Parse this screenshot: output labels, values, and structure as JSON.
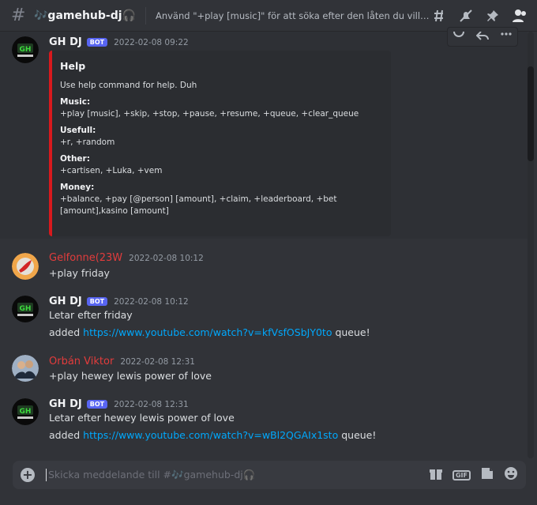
{
  "header": {
    "channel_name": "🎶gamehub-dj🎧",
    "topic": "Använd \"+play [music]\" för att söka efter den låten du vill höra, \"+skip fö...",
    "icons": [
      "threads-icon",
      "muted-bell-icon",
      "pin-icon",
      "members-icon"
    ]
  },
  "message_toolbar": {
    "icons": [
      "add-reaction-icon",
      "reply-icon",
      "more-icon"
    ]
  },
  "messages": [
    {
      "author": "GH DJ",
      "bot_badge": "BOT",
      "timestamp": "2022-02-08 09:22",
      "embed": {
        "title": "Help",
        "description": "Use help command for help. Duh",
        "fields": [
          {
            "name": "Music:",
            "value": "+play [music], +skip, +stop, +pause, +resume, +queue, +clear_queue"
          },
          {
            "name": "Usefull:",
            "value": "+r, +random"
          },
          {
            "name": "Other:",
            "value": "+cartisen, +Luka, +vem"
          },
          {
            "name": "Money:",
            "value": "+balance, +pay [@person] [amount], +claim, +leaderboard, +bet [amount],kasino [amount]"
          }
        ]
      }
    },
    {
      "author": "Gelfonne(23W",
      "timestamp": "2022-02-08 10:12",
      "text": "+play friday"
    },
    {
      "author": "GH DJ",
      "bot_badge": "BOT",
      "timestamp": "2022-02-08 10:12",
      "text": "Letar efter friday",
      "text2_prefix": "added ",
      "text2_link": "https://www.youtube.com/watch?v=kfVsfOSbJY0to",
      "text2_suffix": " queue!"
    },
    {
      "author": "Orbán Viktor",
      "timestamp": "2022-02-08 12:31",
      "text": "+play hewey lewis power of love"
    },
    {
      "author": "GH DJ",
      "bot_badge": "BOT",
      "timestamp": "2022-02-08 12:31",
      "text": "Letar efter hewey lewis power of love",
      "text2_prefix": "added ",
      "text2_link": "https://www.youtube.com/watch?v=wBl2QGAIx1sto",
      "text2_suffix": " queue!"
    }
  ],
  "composer": {
    "placeholder": "Skicka meddelande till #🎶gamehub-dj🎧",
    "gif_label": "GIF",
    "icons": [
      "add-attachment-icon",
      "gift-icon",
      "gif-icon",
      "sticker-icon",
      "emoji-icon"
    ]
  },
  "colors": {
    "accent": "#5865f2",
    "embed_border": "#d8191d",
    "link": "#00a8fc",
    "red_name": "#e23c3c"
  }
}
